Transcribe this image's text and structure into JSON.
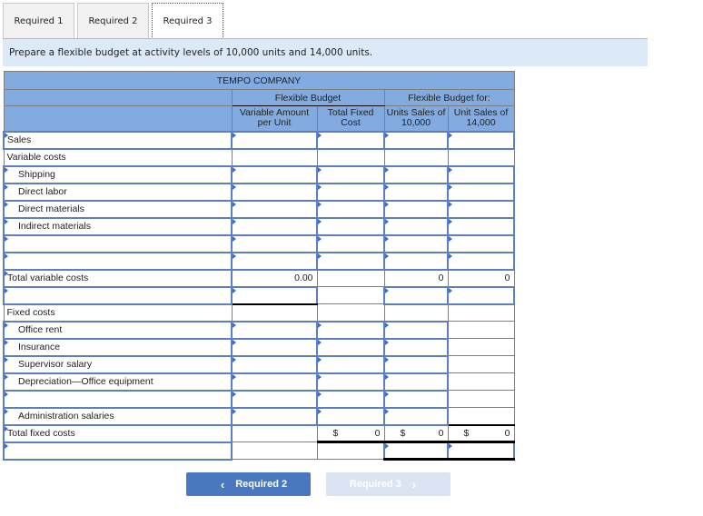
{
  "tabs": [
    {
      "label": "Required 1",
      "active": false
    },
    {
      "label": "Required 2",
      "active": false
    },
    {
      "label": "Required 3",
      "active": true
    }
  ],
  "instruction": "Prepare a flexible budget at activity levels of 10,000 units and 14,000 units.",
  "table": {
    "company": "TEMPO COMPANY",
    "group_flexible_budget": "Flexible Budget",
    "group_flexible_budget_for": "Flexible Budget for:",
    "columns": {
      "variable_amount": "Variable Amount per Unit",
      "total_fixed_cost": "Total Fixed Cost",
      "units_10000": "Units Sales of 10,000",
      "units_14000": "Unit Sales of 14,000"
    },
    "rows": {
      "sales": "Sales",
      "variable_costs": "Variable costs",
      "shipping": "Shipping",
      "direct_labor": "Direct labor",
      "direct_materials": "Direct materials",
      "indirect_materials": "Indirect materials",
      "total_variable_costs": "Total variable costs",
      "fixed_costs": "Fixed costs",
      "office_rent": "Office rent",
      "insurance": "Insurance",
      "supervisor_salary": "Supervisor salary",
      "depreciation": "Depreciation—Office equipment",
      "administration_salaries": "Administration salaries",
      "total_fixed_costs": "Total fixed costs"
    },
    "values": {
      "total_variable_per_unit": "0.00",
      "total_variable_10000": "0",
      "total_variable_14000": "0",
      "currency_symbol": "$",
      "total_fixed_cost": "0",
      "total_fixed_10000": "0",
      "total_fixed_14000": "0"
    }
  },
  "buttons": {
    "prev_label": "Required 2",
    "next_label": "Required 3",
    "prev_icon": "chevron-left",
    "next_icon": "chevron-right"
  }
}
